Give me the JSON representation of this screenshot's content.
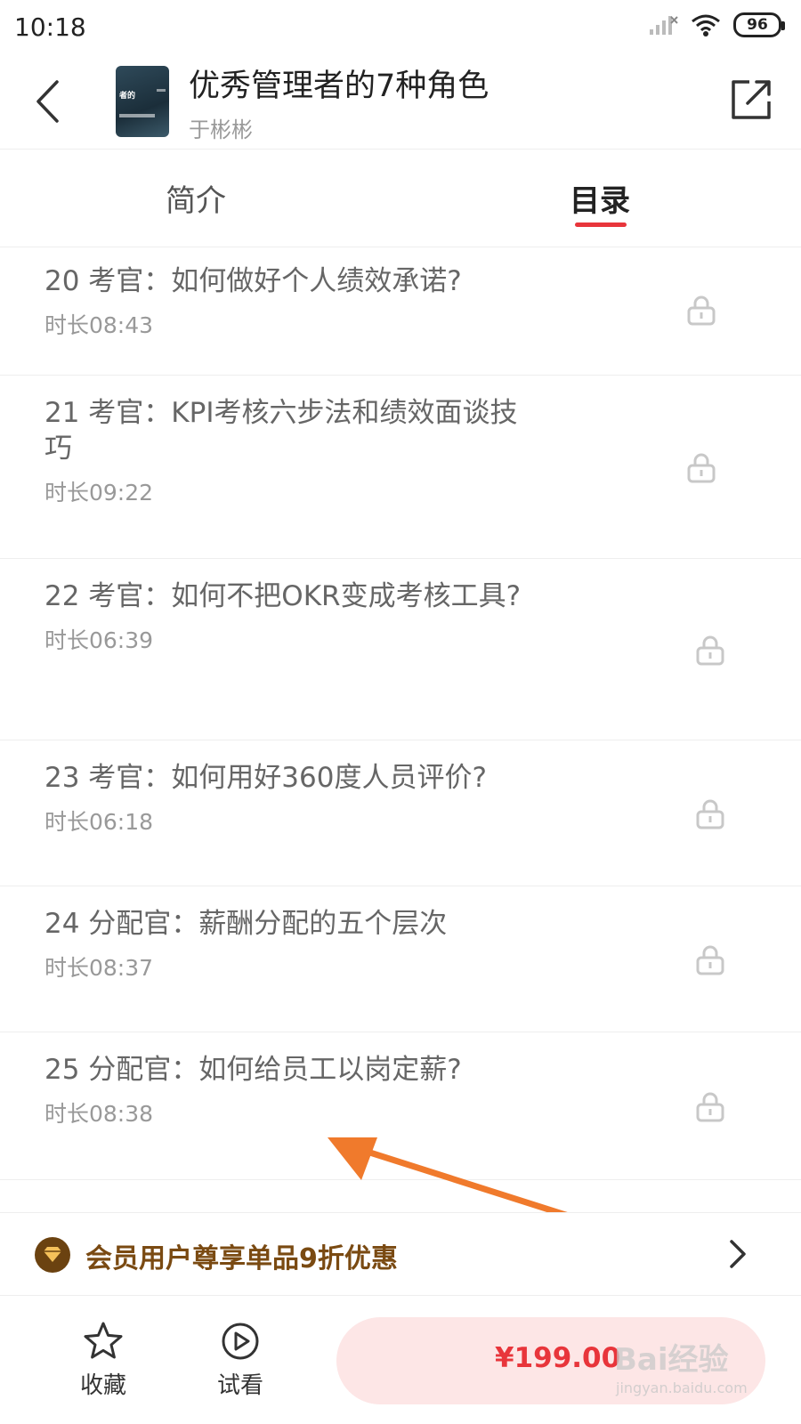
{
  "status_bar": {
    "time": "10:18",
    "battery": "96"
  },
  "header": {
    "back_icon": "chevron-left-icon",
    "cover_caption": "者的",
    "title": "优秀管理者的7种角色",
    "author": "于彬彬",
    "share_icon": "share-icon"
  },
  "tabs": [
    {
      "label": "简介",
      "active": false
    },
    {
      "label": "目录",
      "active": true
    }
  ],
  "accent_color": "#e8353b",
  "lessons": [
    {
      "title": "20 考官：如何做好个人绩效承诺?",
      "duration": "时长08:43",
      "locked": true
    },
    {
      "title": "21 考官：KPI考核六步法和绩效面谈技巧",
      "duration": "时长09:22",
      "locked": true
    },
    {
      "title": "22 考官：如何不把OKR变成考核工具?",
      "duration": "时长06:39",
      "locked": true
    },
    {
      "title": "23 考官：如何用好360度人员评价?",
      "duration": "时长06:18",
      "locked": true
    },
    {
      "title": "24 分配官：薪酬分配的五个层次",
      "duration": "时长08:37",
      "locked": true
    },
    {
      "title": "25 分配官：如何给员工以岗定薪?",
      "duration": "时长08:38",
      "locked": true
    }
  ],
  "promo": {
    "text": "会员用户尊享单品9折优惠",
    "icon": "vip-diamond-icon",
    "color": "#7a4a12"
  },
  "bottom_bar": {
    "favorite_label": "收藏",
    "favorite_icon": "star-icon",
    "trial_label": "试看",
    "trial_icon": "play-circle-icon",
    "price": "¥199.00"
  },
  "watermark": {
    "main": "Bai经验",
    "sub": "jingyan.baidu.com"
  }
}
